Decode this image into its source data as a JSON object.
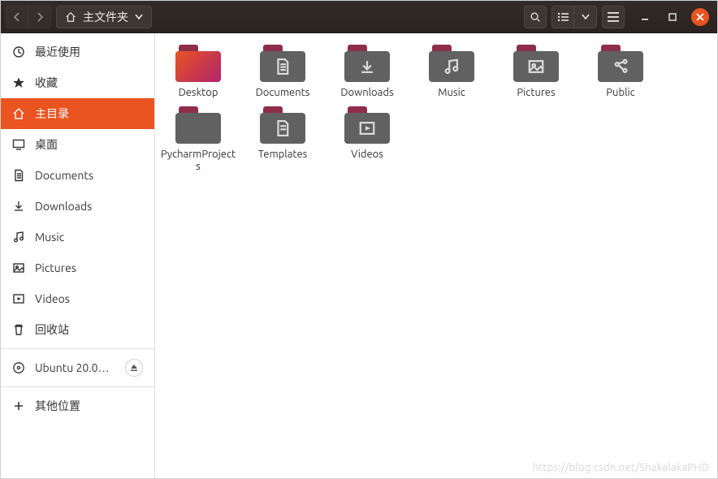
{
  "header": {
    "path_label": "主文件夹"
  },
  "sidebar": {
    "items": [
      {
        "id": "recent",
        "label": "最近使用",
        "icon": "clock-icon"
      },
      {
        "id": "starred",
        "label": "收藏",
        "icon": "star-icon"
      },
      {
        "id": "home",
        "label": "主目录",
        "icon": "home-icon",
        "active": true
      },
      {
        "id": "desktop",
        "label": "桌面",
        "icon": "desktop-icon"
      },
      {
        "id": "documents",
        "label": "Documents",
        "icon": "documents-icon"
      },
      {
        "id": "downloads",
        "label": "Downloads",
        "icon": "downloads-icon"
      },
      {
        "id": "music",
        "label": "Music",
        "icon": "music-icon"
      },
      {
        "id": "pictures",
        "label": "Pictures",
        "icon": "pictures-icon"
      },
      {
        "id": "videos",
        "label": "Videos",
        "icon": "videos-icon"
      },
      {
        "id": "trash",
        "label": "回收站",
        "icon": "trash-icon"
      }
    ],
    "mount": {
      "label": "Ubuntu 20.0…",
      "icon": "disc-icon"
    },
    "other": {
      "label": "其他位置",
      "icon": "plus-icon"
    }
  },
  "content": {
    "items": [
      {
        "label": "Desktop",
        "kind": "desktop",
        "glyph": ""
      },
      {
        "label": "Documents",
        "kind": "folder",
        "glyph": "documents"
      },
      {
        "label": "Downloads",
        "kind": "folder",
        "glyph": "downloads"
      },
      {
        "label": "Music",
        "kind": "folder",
        "glyph": "music"
      },
      {
        "label": "Pictures",
        "kind": "folder",
        "glyph": "pictures"
      },
      {
        "label": "Public",
        "kind": "folder",
        "glyph": "public"
      },
      {
        "label": "PycharmProjects",
        "kind": "folder",
        "glyph": ""
      },
      {
        "label": "Templates",
        "kind": "folder",
        "glyph": "templates"
      },
      {
        "label": "Videos",
        "kind": "folder",
        "glyph": "videos"
      }
    ]
  },
  "watermark": "https://blog.csdn.net/ShakalakaPHD"
}
